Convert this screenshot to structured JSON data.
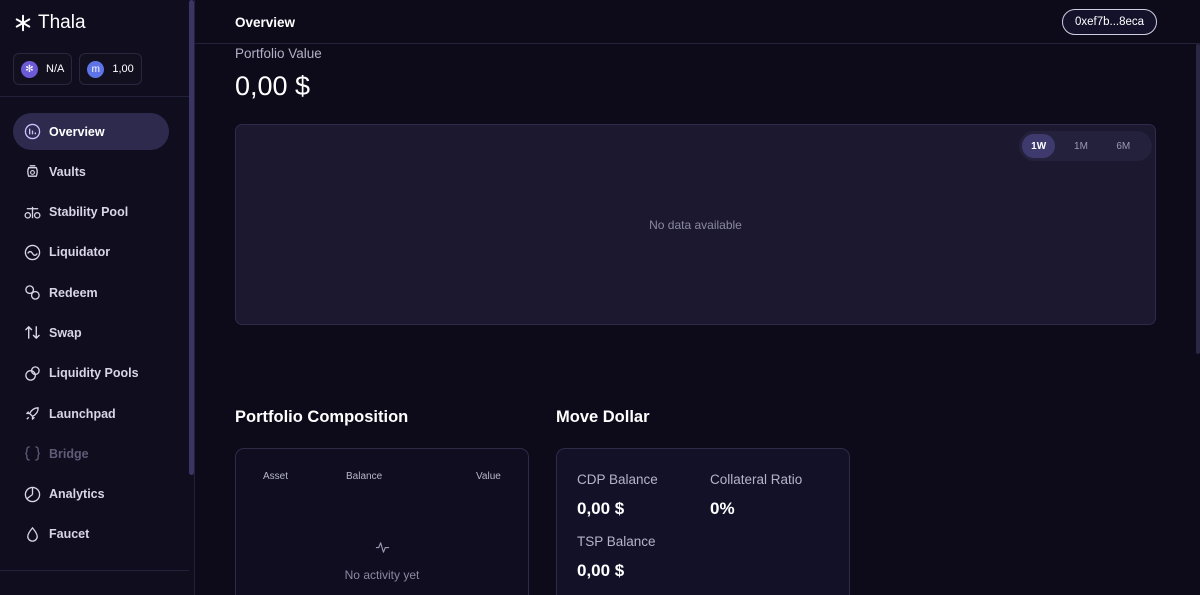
{
  "app": {
    "name": "Thala"
  },
  "tokens": [
    {
      "icon": "thala-token-icon",
      "value": "N/A"
    },
    {
      "icon": "move-dollar-token-icon",
      "value": "1,00"
    }
  ],
  "sidebar": {
    "items": [
      {
        "label": "Overview",
        "icon": "overview-icon",
        "active": true
      },
      {
        "label": "Vaults",
        "icon": "vault-icon"
      },
      {
        "label": "Stability Pool",
        "icon": "scale-icon"
      },
      {
        "label": "Liquidator",
        "icon": "liquidator-icon"
      },
      {
        "label": "Redeem",
        "icon": "redeem-icon"
      },
      {
        "label": "Swap",
        "icon": "swap-icon"
      },
      {
        "label": "Liquidity Pools",
        "icon": "liquidity-pools-icon"
      },
      {
        "label": "Launchpad",
        "icon": "rocket-icon"
      },
      {
        "label": "Bridge",
        "icon": "bridge-icon",
        "disabled": true
      },
      {
        "label": "Analytics",
        "icon": "analytics-icon"
      },
      {
        "label": "Faucet",
        "icon": "droplet-icon"
      }
    ]
  },
  "header": {
    "title": "Overview",
    "wallet": "0xef7b...8eca"
  },
  "portfolio": {
    "label": "Portfolio Value",
    "value": "0,00 $",
    "ranges": [
      "1W",
      "1M",
      "6M"
    ],
    "active_range": "1W",
    "empty_text": "No data available"
  },
  "composition": {
    "title": "Portfolio Composition",
    "columns": [
      "Asset",
      "Balance",
      "Value"
    ],
    "empty_text": "No activity yet"
  },
  "move_dollar": {
    "title": "Move Dollar",
    "cdp_label": "CDP Balance",
    "cdp_value": "0,00 $",
    "ratio_label": "Collateral Ratio",
    "ratio_value": "0%",
    "tsp_label": "TSP Balance",
    "tsp_value": "0,00 $"
  },
  "colors": {
    "background": "#0d0b1a",
    "accent": "#6b5bd6",
    "active_nav": "#2d2a4e"
  }
}
